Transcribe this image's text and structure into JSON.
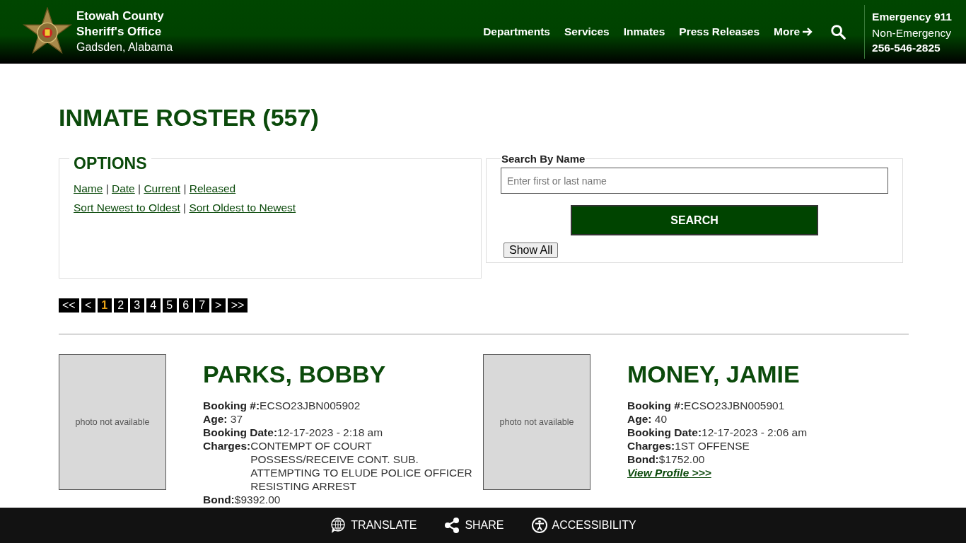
{
  "header": {
    "title_lines": [
      "Etowah County",
      "Sheriff's Office"
    ],
    "subtitle": "Gadsden, Alabama",
    "nav": [
      {
        "label": "Departments",
        "kind": "link"
      },
      {
        "label": "Services",
        "kind": "link"
      },
      {
        "label": "Inmates",
        "kind": "link"
      },
      {
        "label": "Press Releases",
        "kind": "link"
      },
      {
        "label": "More",
        "kind": "arrow"
      },
      {
        "kind": "search"
      }
    ],
    "emergency": {
      "line": "Emergency 911",
      "label": "Non-Emergency",
      "phone": "256-546-2825"
    }
  },
  "page_title": "INMATE ROSTER (557)",
  "options": {
    "legend": "OPTIONS",
    "separator": "|",
    "lines": [
      {
        "links": [
          "Name",
          "Date",
          "Current",
          "Released"
        ]
      },
      {
        "links": [
          "Sort Newest to Oldest",
          "Sort Oldest to Newest"
        ]
      }
    ]
  },
  "search": {
    "label": "Search By Name",
    "placeholder": "Enter first or last name",
    "button": "SEARCH",
    "show_all": "Show All"
  },
  "pagination": [
    {
      "label": "<<",
      "selected": false
    },
    {
      "label": "<",
      "selected": false
    },
    {
      "label": "1",
      "selected": true
    },
    {
      "label": "2",
      "selected": false
    },
    {
      "label": "3",
      "selected": false
    },
    {
      "label": "4",
      "selected": false
    },
    {
      "label": "5",
      "selected": false
    },
    {
      "label": "6",
      "selected": false
    },
    {
      "label": "7",
      "selected": false
    },
    {
      "label": ">",
      "selected": false
    },
    {
      "label": ">>",
      "selected": false
    }
  ],
  "inmates": [
    {
      "photo_text": "photo not available",
      "name": "PARKS, BOBBY",
      "fields": [
        {
          "label": "Booking #:",
          "value": "ECSO23JBN005902"
        },
        {
          "label": "Age:",
          "value": " 37"
        },
        {
          "label": "Booking Date:",
          "value": "12-17-2023 - 2:18 am"
        }
      ],
      "charges_label": "Charges:",
      "charges": [
        "CONTEMPT OF COURT",
        "POSSESS/RECEIVE CONT. SUB.",
        "ATTEMPTING TO ELUDE POLICE OFFICER",
        "RESISTING ARREST"
      ],
      "bond_label": "Bond:",
      "bond": "$9392.00"
    },
    {
      "photo_text": "photo not available",
      "name": "MONEY, JAMIE",
      "fields": [
        {
          "label": "Booking #:",
          "value": "ECSO23JBN005901"
        },
        {
          "label": "Age:",
          "value": " 40"
        },
        {
          "label": "Booking Date:",
          "value": "12-17-2023 - 2:06 am"
        }
      ],
      "charges_label": "Charges:",
      "charges": [
        "1ST OFFENSE"
      ],
      "bond_label": "Bond:",
      "bond": "$1752.00",
      "profile_link": "View Profile >>>"
    }
  ],
  "footer": [
    {
      "label": "TRANSLATE",
      "kind": "globe"
    },
    {
      "label": "SHARE",
      "kind": "share"
    },
    {
      "label": "ACCESSIBILITY",
      "kind": "accessibility"
    }
  ]
}
